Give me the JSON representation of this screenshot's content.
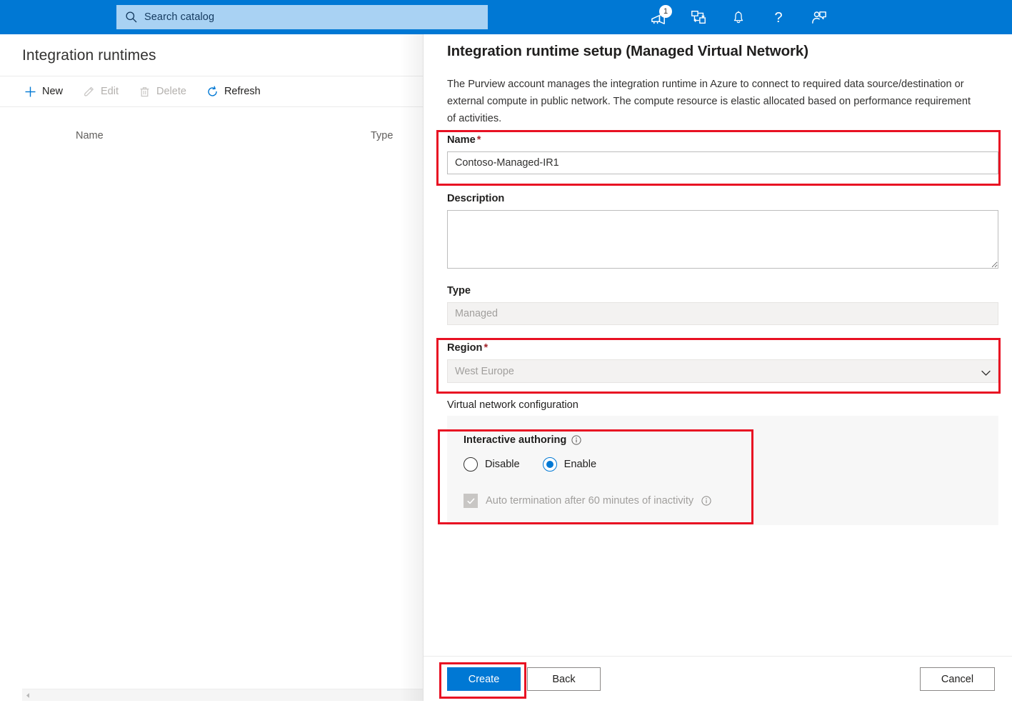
{
  "topbar": {
    "search": {
      "placeholder": "Search catalog",
      "value": "",
      "icon": "search-icon"
    },
    "icons": [
      {
        "name": "whats-new-icon",
        "badge": "1"
      },
      {
        "name": "sitemap-icon",
        "badge": ""
      },
      {
        "name": "notifications-bell-icon",
        "badge": ""
      },
      {
        "name": "help-question-icon",
        "badge": ""
      },
      {
        "name": "feedback-person-icon",
        "badge": ""
      }
    ],
    "accent_color": "#0078d4",
    "search_bg_color": "#a9d2f3"
  },
  "left_page": {
    "title": "Integration runtimes",
    "commands": [
      {
        "label": "New",
        "icon": "plus-icon",
        "enabled": true
      },
      {
        "label": "Edit",
        "icon": "pencil-icon",
        "enabled": false
      },
      {
        "label": "Delete",
        "icon": "trash-icon",
        "enabled": false
      },
      {
        "label": "Refresh",
        "icon": "refresh-icon",
        "enabled": true
      }
    ],
    "table": {
      "columns": [
        "Name",
        "Type"
      ],
      "rows": []
    },
    "scrollbar": {
      "orientation": "horizontal",
      "left_arrow_icon": "chevron-left-icon"
    }
  },
  "panel": {
    "title": "Integration runtime setup (Managed Virtual Network)",
    "description": "The Purview account manages the integration runtime in Azure to connect to required data source/destination or external compute in public network. The compute resource is elastic allocated based on performance requirement of activities.",
    "fields": {
      "name": {
        "label": "Name",
        "required_marker": "*",
        "value": "Contoso-Managed-IR1",
        "placeholder": "",
        "highlighted": true
      },
      "description": {
        "label": "Description",
        "value": "",
        "placeholder": "",
        "highlighted": false
      },
      "type": {
        "label": "Type",
        "value": "Managed",
        "readonly": true,
        "highlighted": false
      },
      "region": {
        "label": "Region",
        "required_marker": "*",
        "value": "West Europe",
        "options": [
          "West Europe"
        ],
        "chevron_icon": "chevron-down-icon",
        "highlighted": true
      }
    },
    "vnet": {
      "section_label": "Virtual network configuration",
      "interactive_authoring": {
        "label": "Interactive authoring",
        "info_icon": "info-circle-icon",
        "options": [
          {
            "label": "Disable",
            "selected": false
          },
          {
            "label": "Enable",
            "selected": true
          }
        ],
        "auto_termination": {
          "label": "Auto termination after 60 minutes of inactivity",
          "checked": true,
          "disabled": true,
          "info_icon": "info-circle-icon"
        },
        "highlighted": true
      }
    },
    "footer": {
      "create_label": "Create",
      "back_label": "Back",
      "cancel_label": "Cancel",
      "create_highlighted": true
    }
  },
  "highlight_color": "#e81123"
}
